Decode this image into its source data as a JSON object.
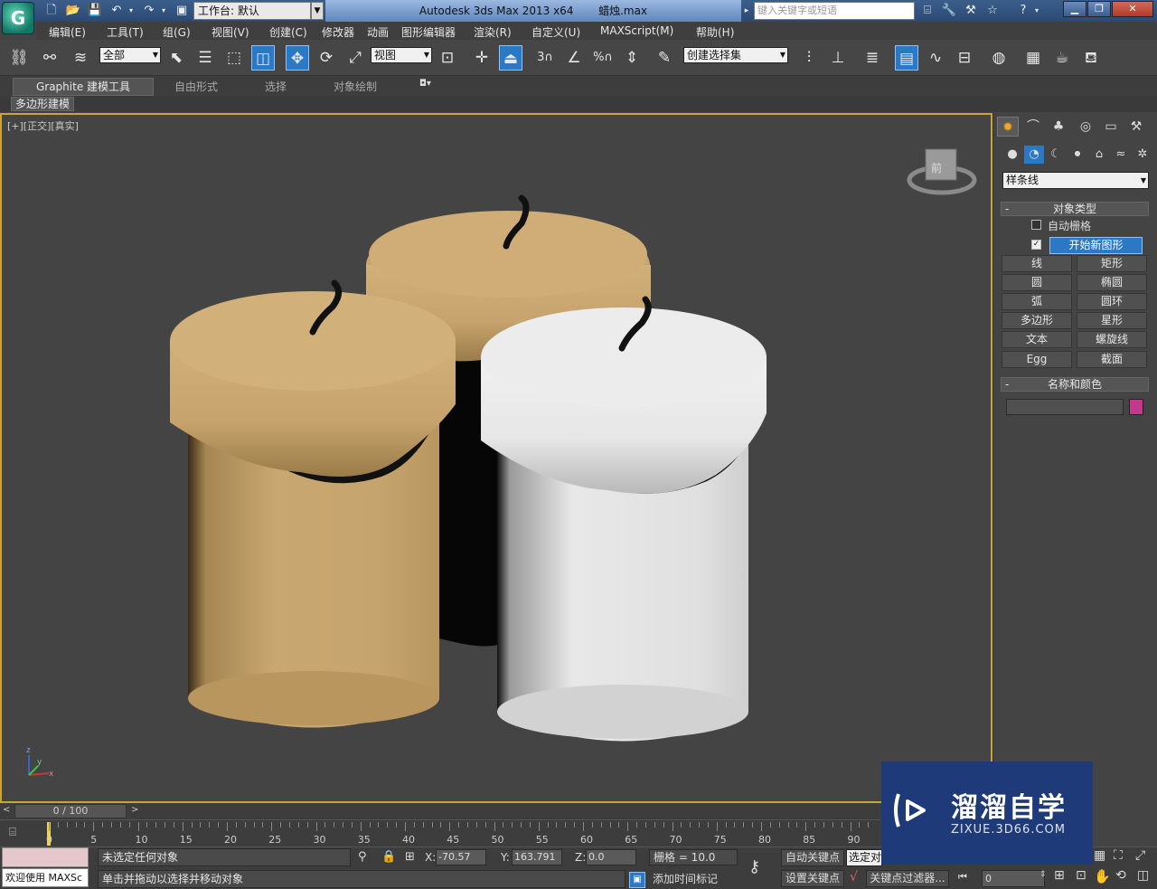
{
  "titlebar": {
    "logo_text": "G",
    "workspace": "工作台: 默认",
    "app_title": "Autodesk 3ds Max  2013 x64",
    "filename": "蜡烛.max",
    "search_placeholder": "键入关键字或短语",
    "accent": "#2b78c5"
  },
  "menu": [
    "编辑(E)",
    "工具(T)",
    "组(G)",
    "视图(V)",
    "创建(C)",
    "修改器",
    "动画",
    "图形编辑器",
    "渲染(R)",
    "自定义(U)",
    "MAXScript(M)",
    "帮助(H)"
  ],
  "toolbar": {
    "selection_filter": "全部",
    "ref_coord": "视图",
    "named_selection": "创建选择集",
    "snap_labels": [
      "3",
      "%"
    ]
  },
  "ribbon": {
    "tabs": [
      "Graphite 建模工具",
      "自由形式",
      "选择",
      "对象绘制"
    ],
    "sub_tab": "多边形建模"
  },
  "viewport": {
    "label": "[+][正交][真实]",
    "viewcube_label": "前",
    "axis_labels": [
      "z",
      "y",
      "x"
    ],
    "candle_colors": {
      "tan": "#c6a46f",
      "white": "#e2e2e2"
    }
  },
  "panel": {
    "category": "样条线",
    "rollout_object_type": "对象类型",
    "auto_grid": "自动栅格",
    "start_new_shape": "开始新图形",
    "buttons": [
      "线",
      "矩形",
      "圆",
      "椭圆",
      "弧",
      "圆环",
      "多边形",
      "星形",
      "文本",
      "螺旋线",
      "Egg",
      "截面"
    ],
    "rollout_name_color": "名称和颜色",
    "swatch_color": "#c0398a"
  },
  "timeline": {
    "frame_display": "0 / 100",
    "ticks": [
      "0",
      "5",
      "10",
      "15",
      "20",
      "25",
      "30",
      "35",
      "40",
      "45",
      "50",
      "55",
      "60",
      "65",
      "70",
      "75",
      "80",
      "85",
      "90"
    ]
  },
  "status": {
    "maxscript": "欢迎使用 MAXSc",
    "line1": "未选定任何对象",
    "line2": "单击并拖动以选择并移动对象",
    "x_value": "-70.57",
    "y_value": "163.791",
    "z_value": "0.0",
    "grid": "栅格 = 10.0",
    "add_time_tag": "添加时间标记",
    "auto_key": "自动关键点",
    "selected": "选定对",
    "set_key": "设置关键点",
    "key_filters": "关键点过滤器...",
    "frame": "0"
  },
  "watermark": {
    "brand": "溜溜自学",
    "url": "ZIXUE.3D66.COM"
  }
}
